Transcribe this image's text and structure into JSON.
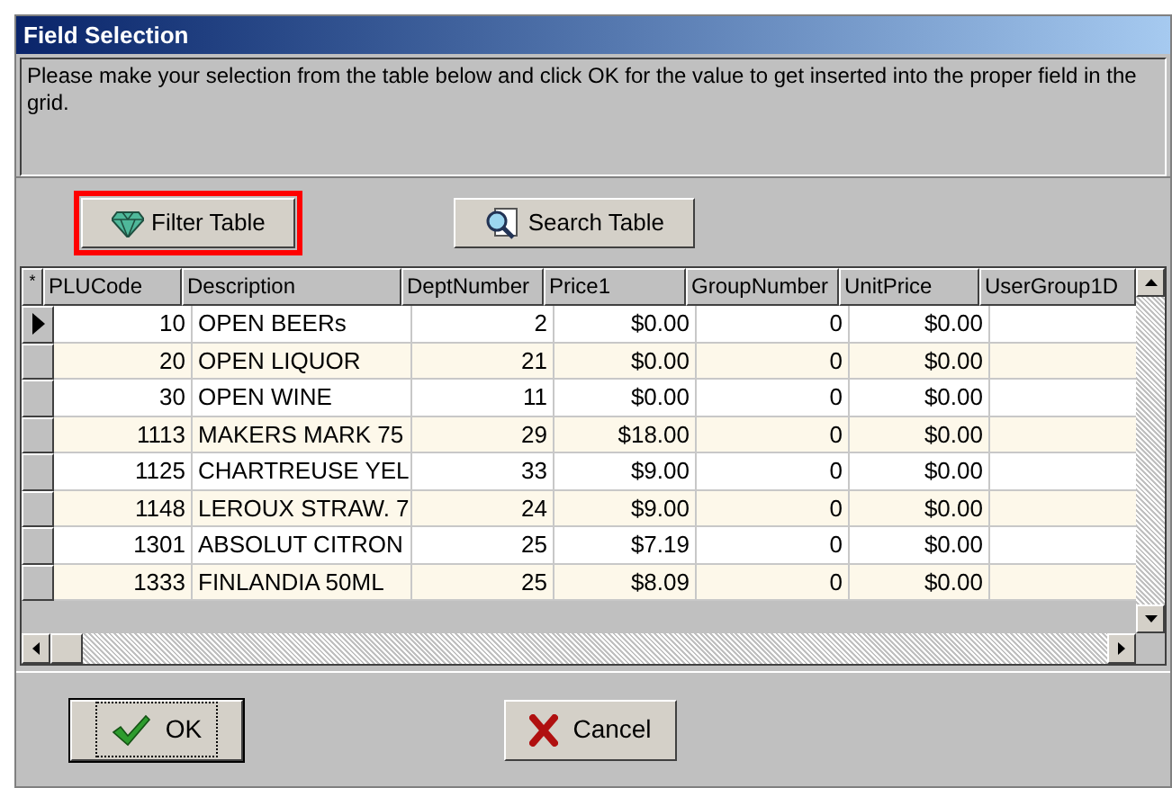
{
  "window": {
    "title": "Field Selection"
  },
  "instructions": "Please make your selection from the table below and click OK for the value to get inserted into the proper field in the grid.",
  "toolbar": [
    {
      "label": "Filter Table",
      "kind": "filter",
      "highlighted": true
    },
    {
      "label": "Search Table",
      "kind": "search",
      "highlighted": false
    }
  ],
  "table": {
    "corner": "*",
    "columns": [
      {
        "label": "PLUCode",
        "kind": "number"
      },
      {
        "label": "Description",
        "kind": "text"
      },
      {
        "label": "DeptNumber",
        "kind": "number"
      },
      {
        "label": "Price1",
        "kind": "number"
      },
      {
        "label": "GroupNumber",
        "kind": "number"
      },
      {
        "label": "UnitPrice",
        "kind": "number"
      },
      {
        "label": "UserGroup1D",
        "kind": "text"
      }
    ],
    "rows": [
      {
        "selected": true,
        "cells": [
          "10",
          "OPEN BEERs",
          "2",
          "$0.00",
          "0",
          "$0.00",
          ""
        ]
      },
      {
        "selected": false,
        "cells": [
          "20",
          "OPEN LIQUOR",
          "21",
          "$0.00",
          "0",
          "$0.00",
          ""
        ]
      },
      {
        "selected": false,
        "cells": [
          "30",
          "OPEN WINE",
          "11",
          "$0.00",
          "0",
          "$0.00",
          ""
        ]
      },
      {
        "selected": false,
        "cells": [
          "1113",
          "MAKERS MARK 75",
          "29",
          "$18.00",
          "0",
          "$0.00",
          ""
        ]
      },
      {
        "selected": false,
        "cells": [
          "1125",
          "CHARTREUSE YEL",
          "33",
          "$9.00",
          "0",
          "$0.00",
          ""
        ]
      },
      {
        "selected": false,
        "cells": [
          "1148",
          "LEROUX STRAW. 7",
          "24",
          "$9.00",
          "0",
          "$0.00",
          ""
        ]
      },
      {
        "selected": false,
        "cells": [
          "1301",
          "ABSOLUT CITRON",
          "25",
          "$7.19",
          "0",
          "$0.00",
          ""
        ]
      },
      {
        "selected": false,
        "cells": [
          "1333",
          "FINLANDIA 50ML",
          "25",
          "$8.09",
          "0",
          "$0.00",
          ""
        ]
      }
    ]
  },
  "buttons": [
    {
      "label": "OK",
      "kind": "ok",
      "focused": true
    },
    {
      "label": "Cancel",
      "kind": "cancel",
      "focused": false
    }
  ]
}
